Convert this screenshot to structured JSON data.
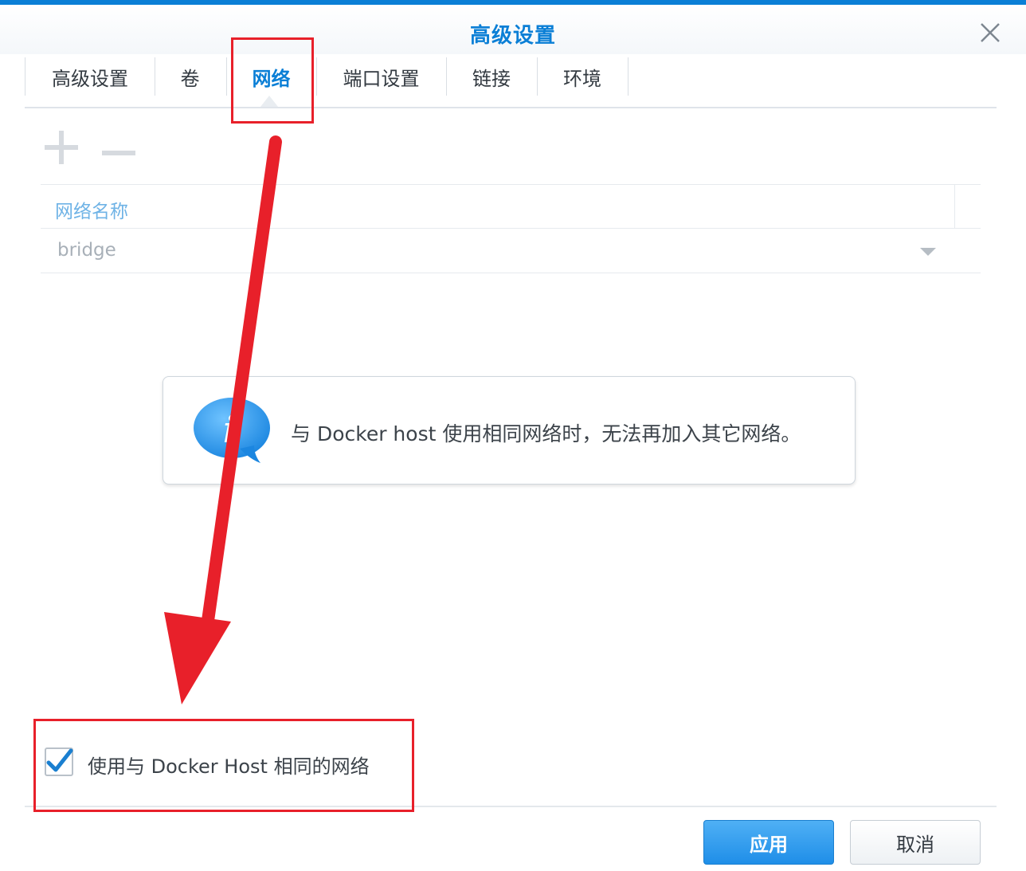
{
  "dialog": {
    "title": "高级设置",
    "close_icon": "close-icon"
  },
  "tabs": [
    {
      "label": "高级设置",
      "active": false
    },
    {
      "label": "卷",
      "active": false
    },
    {
      "label": "网络",
      "active": true
    },
    {
      "label": "端口设置",
      "active": false
    },
    {
      "label": "链接",
      "active": false
    },
    {
      "label": "环境",
      "active": false
    }
  ],
  "toolbar": {
    "add_icon": "plus-icon",
    "remove_icon": "minus-icon"
  },
  "grid": {
    "header": "网络名称",
    "rows": [
      {
        "name": "bridge"
      }
    ]
  },
  "info": {
    "icon": "info-bubble-icon",
    "text": "与 Docker host 使用相同网络时，无法再加入其它网络。"
  },
  "host_network": {
    "checked": true,
    "label": "使用与 Docker Host 相同的网络"
  },
  "buttons": {
    "apply": "应用",
    "cancel": "取消"
  },
  "colors": {
    "accent": "#0b7fd6",
    "annotation": "#e8202a"
  }
}
